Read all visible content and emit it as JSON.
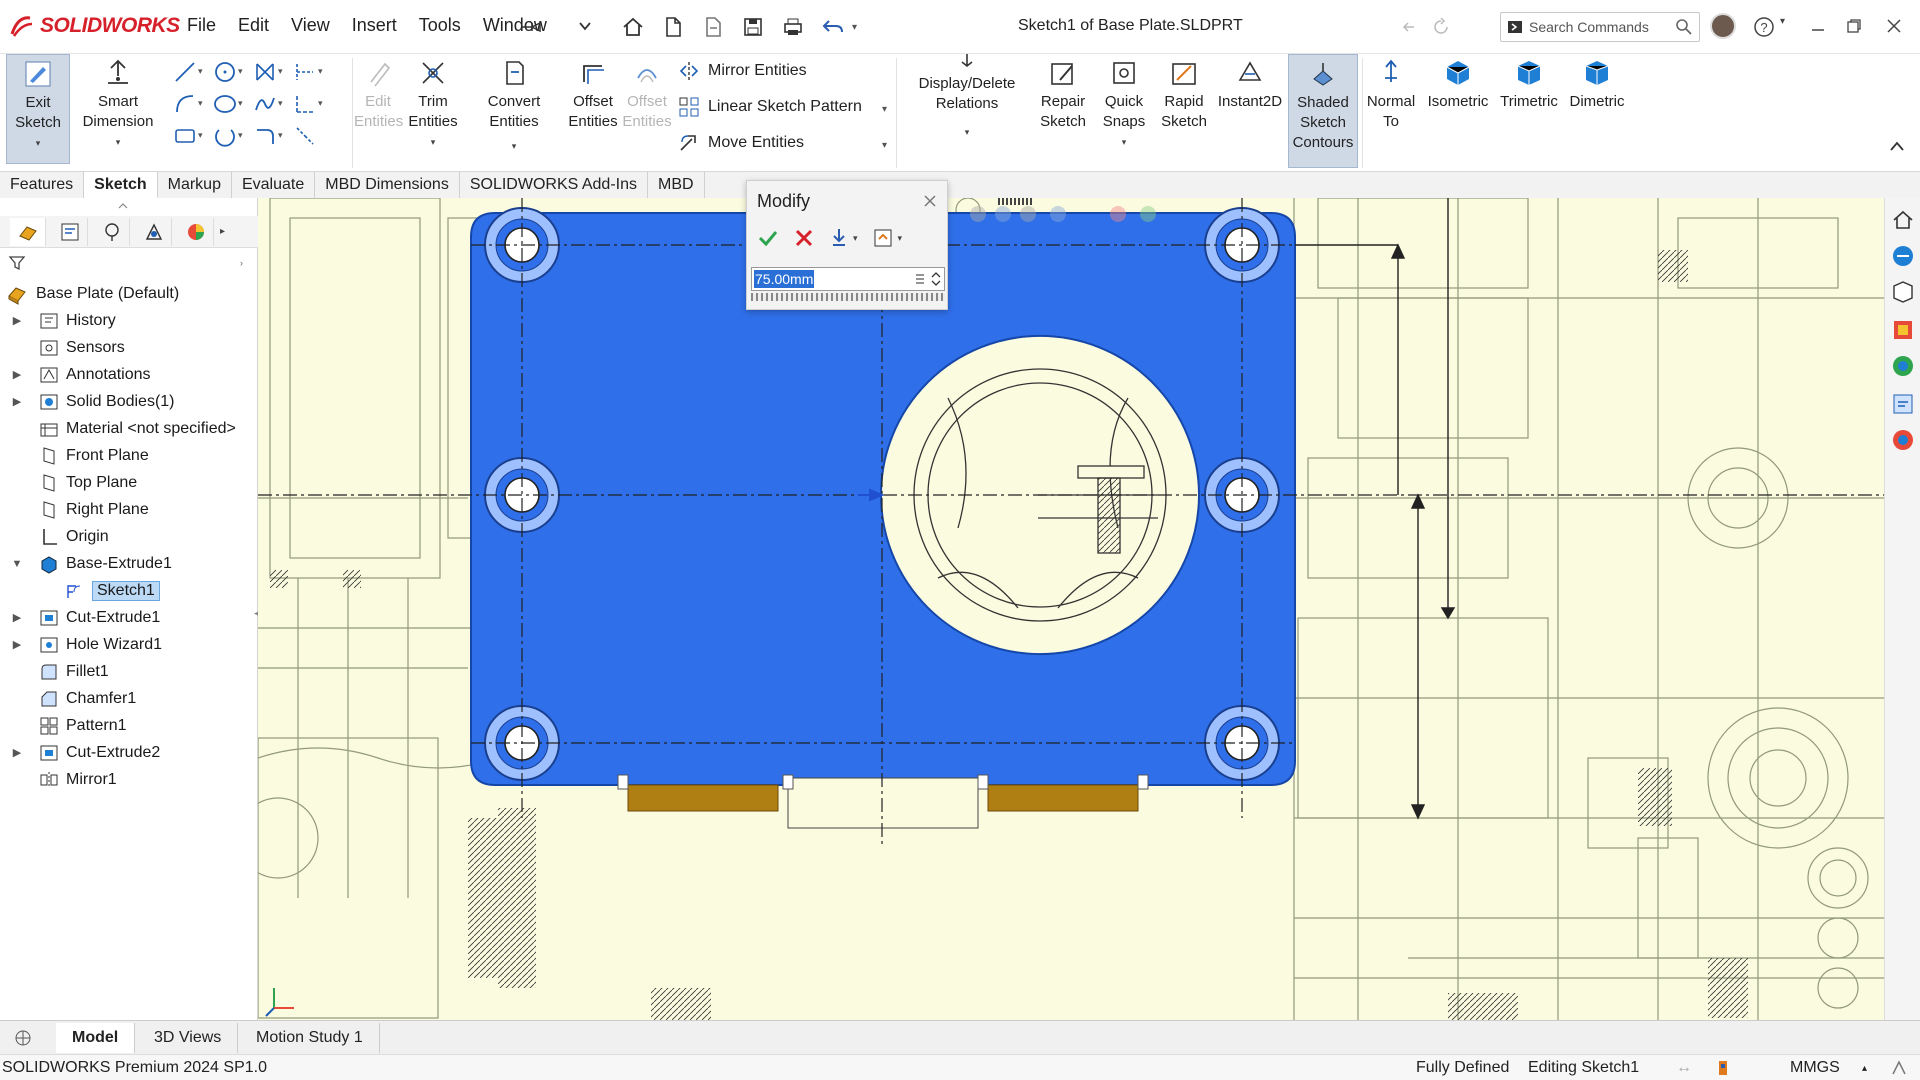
{
  "app": {
    "brand": "SOLIDWORKS",
    "document_title": "Sketch1 of Base Plate.SLDPRT",
    "menu": [
      "File",
      "Edit",
      "View",
      "Insert",
      "Tools",
      "Window"
    ],
    "search_placeholder": "Search Commands",
    "accent_color": "#d6212b"
  },
  "ribbon": {
    "exit_sketch": "Exit\nSketch",
    "smart_dimension": "Smart\nDimension",
    "trim_entities": "Trim\nEntities",
    "trim_entities_disabled": "Edit\nEntities",
    "convert_entities": "Convert Entities",
    "offset_entities": "Offset\nEntities",
    "offset_on_surface": "Offset\nEntities",
    "mirror_entities": "Mirror Entities",
    "linear_sketch_pattern": "Linear Sketch Pattern",
    "move_entities": "Move Entities",
    "display_delete_relations": "Display/Delete\nRelations",
    "repair_sketch": "Repair\nSketch",
    "quick_snaps": "Quick\nSnaps",
    "rapid_sketch": "Rapid\nSketch",
    "instant2d": "Instant2D",
    "shaded_sketch_contours": "Shaded\nSketch\nContours",
    "normal_to": "Normal\nTo",
    "isometric": "Isometric",
    "trimetric": "Trimetric",
    "dimetric": "Dimetric"
  },
  "command_tabs": [
    "Features",
    "Sketch",
    "Markup",
    "Evaluate",
    "MBD Dimensions",
    "SOLIDWORKS Add-Ins",
    "MBD"
  ],
  "active_command_tab": "Sketch",
  "feature_tree": {
    "root": "Base Plate  (Default)",
    "items": [
      {
        "label": "History",
        "icon": "history-icon",
        "expander": "right",
        "indent": 1
      },
      {
        "label": "Sensors",
        "icon": "sensors-icon",
        "expander": "",
        "indent": 1
      },
      {
        "label": "Annotations",
        "icon": "annotations-icon",
        "expander": "right",
        "indent": 1
      },
      {
        "label": "Solid Bodies(1)",
        "icon": "solid-bodies-icon",
        "expander": "right",
        "indent": 1
      },
      {
        "label": "Material <not specified>",
        "icon": "material-icon",
        "expander": "",
        "indent": 1
      },
      {
        "label": "Front Plane",
        "icon": "plane-icon",
        "expander": "",
        "indent": 1
      },
      {
        "label": "Top Plane",
        "icon": "plane-icon",
        "expander": "",
        "indent": 1
      },
      {
        "label": "Right Plane",
        "icon": "plane-icon",
        "expander": "",
        "indent": 1
      },
      {
        "label": "Origin",
        "icon": "origin-icon",
        "expander": "",
        "indent": 1
      },
      {
        "label": "Base-Extrude1",
        "icon": "extrude-icon",
        "expander": "down",
        "indent": 1
      },
      {
        "label": "Sketch1",
        "icon": "sketch-icon",
        "expander": "",
        "indent": 2,
        "selected": true
      },
      {
        "label": "Cut-Extrude1",
        "icon": "cut-extrude-icon",
        "expander": "right",
        "indent": 1
      },
      {
        "label": "Hole Wizard1",
        "icon": "hole-wizard-icon",
        "expander": "right",
        "indent": 1
      },
      {
        "label": "Fillet1",
        "icon": "fillet-icon",
        "expander": "",
        "indent": 1
      },
      {
        "label": "Chamfer1",
        "icon": "chamfer-icon",
        "expander": "",
        "indent": 1
      },
      {
        "label": "Pattern1",
        "icon": "pattern-icon",
        "expander": "",
        "indent": 1
      },
      {
        "label": "Cut-Extrude2",
        "icon": "cut-extrude-icon",
        "expander": "right",
        "indent": 1
      },
      {
        "label": "Mirror1",
        "icon": "mirror-icon",
        "expander": "",
        "indent": 1
      }
    ]
  },
  "modify_dialog": {
    "title": "Modify",
    "value": "75.00mm"
  },
  "bottom_tabs": [
    "Model",
    "3D Views",
    "Motion Study 1"
  ],
  "active_bottom_tab": "Model",
  "status_bar": {
    "product": "SOLIDWORKS Premium 2024 SP1.0",
    "sketch_state": "Fully Defined",
    "editing": "Editing Sketch1",
    "units": "MMGS"
  },
  "colors": {
    "plate_fill": "#2f6fe9",
    "drawing_background": "#fbfbe0",
    "selection_highlight": "#bcd9f6"
  }
}
